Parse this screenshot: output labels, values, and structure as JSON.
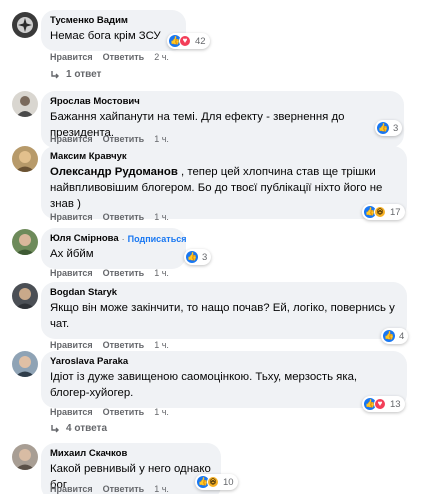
{
  "comments": [
    {
      "author": "Тусменко Вадим",
      "text": "Немає бога крім ЗСУ",
      "reactions": {
        "icons": [
          "like-icon",
          "love-icon"
        ],
        "count": "42"
      },
      "actions": {
        "like": "Нравится",
        "reply": "Ответить",
        "time": "2 ч."
      },
      "replies_label": "1 ответ"
    },
    {
      "author": "Ярослав Мостович",
      "text": "Бажання хайпанути на темі. Для ефекту - звернення до президента.",
      "reactions": {
        "icons": [
          "like-icon"
        ],
        "count": "3"
      },
      "actions": {
        "like": "Нравится",
        "reply": "Ответить",
        "time": "1 ч."
      }
    },
    {
      "author": "Максим Кравчук",
      "mention": "Олександр Рудоманов",
      "text": ", тепер цей хлопчина став ще трішки найвпливовішим блогером. Бо до твоєї публікації ніхто його не знав )",
      "reactions": {
        "icons": [
          "like-icon",
          "haha-icon"
        ],
        "count": "17"
      },
      "actions": {
        "like": "Нравится",
        "reply": "Ответить",
        "time": "1 ч."
      }
    },
    {
      "author": "Юля Смірнова",
      "subscribe": "Подписаться",
      "text": "Ах йбйм",
      "reactions": {
        "icons": [
          "like-icon"
        ],
        "count": "3"
      },
      "actions": {
        "like": "Нравится",
        "reply": "Ответить",
        "time": "1 ч."
      }
    },
    {
      "author": "Bogdan Staryk",
      "text": "Якщо він може закінчити, то нащо почав? Ей, логіко, повернись у чат.",
      "reactions": {
        "icons": [
          "like-icon"
        ],
        "count": "4"
      },
      "actions": {
        "like": "Нравится",
        "reply": "Ответить",
        "time": "1 ч."
      }
    },
    {
      "author": "Yaroslava Paraka",
      "text": "Ідіот із дуже завищеною саомоцінкою. Тьху, мерзость яка, блогер-хуйогер.",
      "reactions": {
        "icons": [
          "like-icon",
          "love-icon"
        ],
        "count": "13"
      },
      "actions": {
        "like": "Нравится",
        "reply": "Ответить",
        "time": "1 ч."
      },
      "replies_label": "4 ответа"
    },
    {
      "author": "Михаил Скачков",
      "text": "Какой ревнивый у него однако бог",
      "reactions": {
        "icons": [
          "like-icon",
          "haha-icon"
        ],
        "count": "10"
      },
      "actions": {
        "like": "Нравится",
        "reply": "Ответить",
        "time": "1 ч."
      }
    }
  ],
  "colors": {
    "bubble_bg": "#f0f2f5",
    "secondary_text": "#65676b",
    "like_blue": "#1877f2",
    "love_red": "#f33e58",
    "haha_yellow": "#f7b125"
  }
}
